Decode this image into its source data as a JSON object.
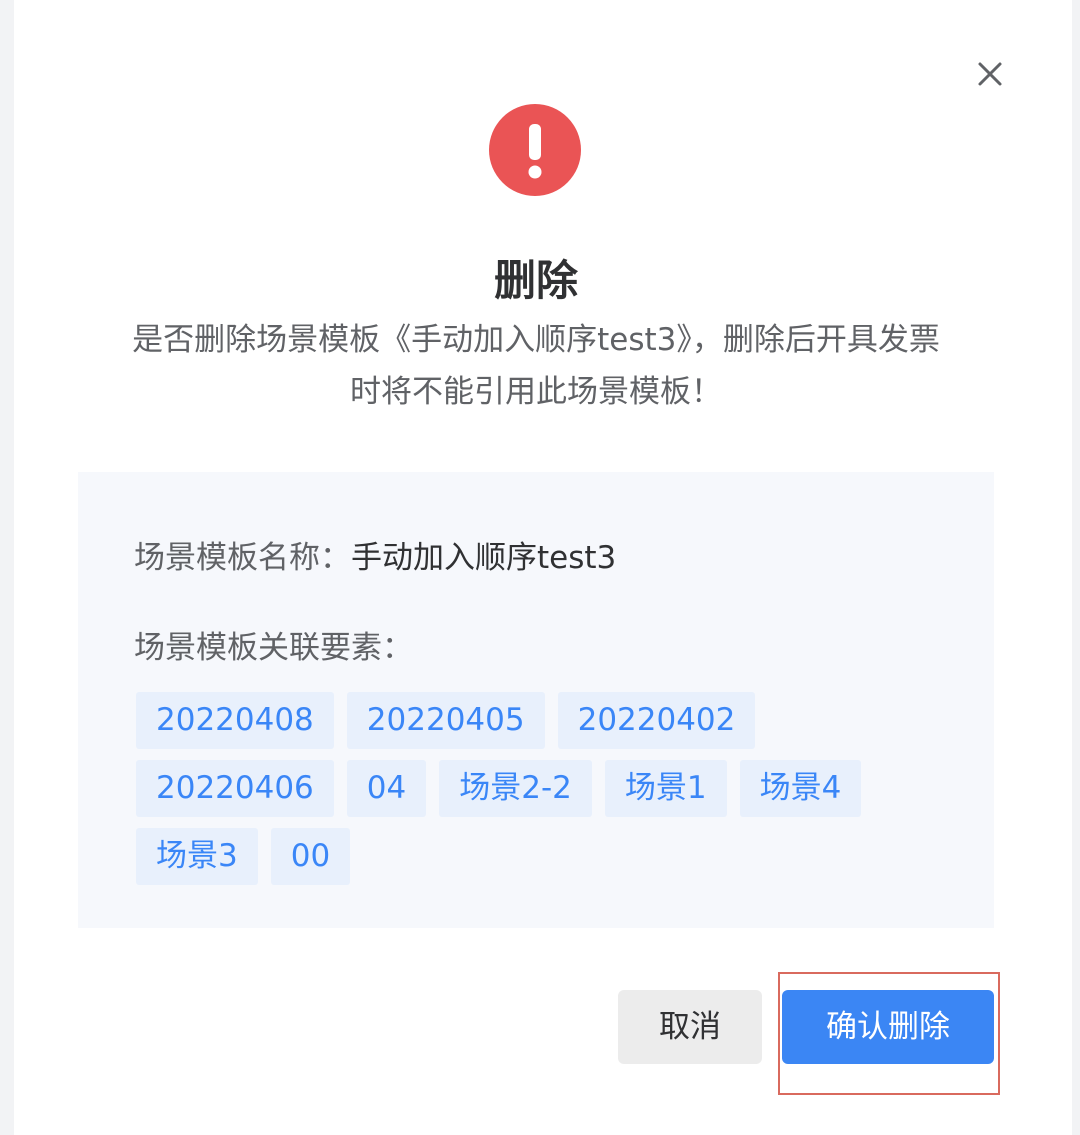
{
  "dialog": {
    "title": "删除",
    "message_line1": "是否删除场景模板《手动加入顺序test3》，删除后开具发票",
    "message_line2": "时将不能引用此场景模板！",
    "close_icon": "close-icon",
    "alert_icon": "exclamation-circle-icon",
    "alert_color": "#ea5455"
  },
  "details": {
    "name_label": "场景模板名称：",
    "name_value": "手动加入顺序test3",
    "elements_label": "场景模板关联要素：",
    "tags": [
      "20220408",
      "20220405",
      "20220402",
      "20220406",
      "04",
      "场景2-2",
      "场景1",
      "场景4",
      "场景3",
      "00"
    ]
  },
  "buttons": {
    "cancel_label": "取消",
    "confirm_label": "确认删除",
    "primary_color": "#3b86f4"
  }
}
